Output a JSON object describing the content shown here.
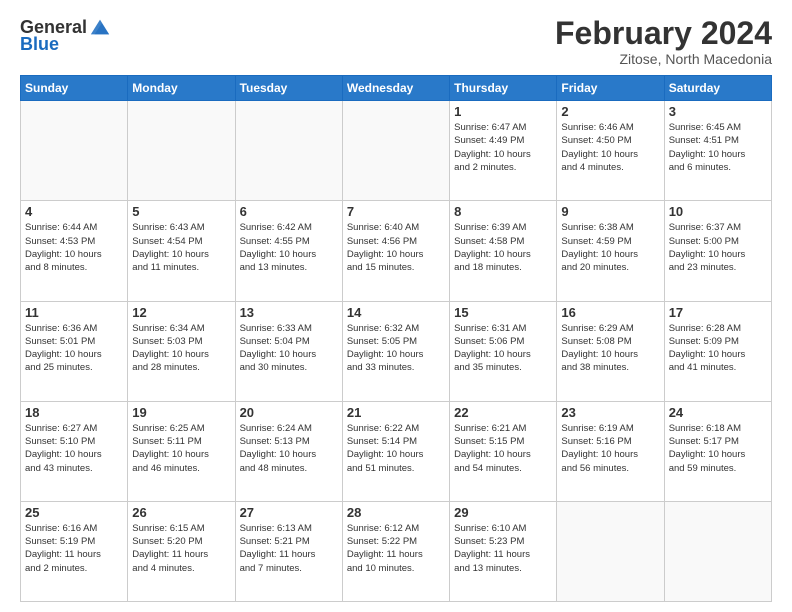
{
  "header": {
    "logo_general": "General",
    "logo_blue": "Blue",
    "month_title": "February 2024",
    "location": "Zitose, North Macedonia"
  },
  "days_of_week": [
    "Sunday",
    "Monday",
    "Tuesday",
    "Wednesday",
    "Thursday",
    "Friday",
    "Saturday"
  ],
  "weeks": [
    [
      {
        "day": "",
        "info": ""
      },
      {
        "day": "",
        "info": ""
      },
      {
        "day": "",
        "info": ""
      },
      {
        "day": "",
        "info": ""
      },
      {
        "day": "1",
        "info": "Sunrise: 6:47 AM\nSunset: 4:49 PM\nDaylight: 10 hours\nand 2 minutes."
      },
      {
        "day": "2",
        "info": "Sunrise: 6:46 AM\nSunset: 4:50 PM\nDaylight: 10 hours\nand 4 minutes."
      },
      {
        "day": "3",
        "info": "Sunrise: 6:45 AM\nSunset: 4:51 PM\nDaylight: 10 hours\nand 6 minutes."
      }
    ],
    [
      {
        "day": "4",
        "info": "Sunrise: 6:44 AM\nSunset: 4:53 PM\nDaylight: 10 hours\nand 8 minutes."
      },
      {
        "day": "5",
        "info": "Sunrise: 6:43 AM\nSunset: 4:54 PM\nDaylight: 10 hours\nand 11 minutes."
      },
      {
        "day": "6",
        "info": "Sunrise: 6:42 AM\nSunset: 4:55 PM\nDaylight: 10 hours\nand 13 minutes."
      },
      {
        "day": "7",
        "info": "Sunrise: 6:40 AM\nSunset: 4:56 PM\nDaylight: 10 hours\nand 15 minutes."
      },
      {
        "day": "8",
        "info": "Sunrise: 6:39 AM\nSunset: 4:58 PM\nDaylight: 10 hours\nand 18 minutes."
      },
      {
        "day": "9",
        "info": "Sunrise: 6:38 AM\nSunset: 4:59 PM\nDaylight: 10 hours\nand 20 minutes."
      },
      {
        "day": "10",
        "info": "Sunrise: 6:37 AM\nSunset: 5:00 PM\nDaylight: 10 hours\nand 23 minutes."
      }
    ],
    [
      {
        "day": "11",
        "info": "Sunrise: 6:36 AM\nSunset: 5:01 PM\nDaylight: 10 hours\nand 25 minutes."
      },
      {
        "day": "12",
        "info": "Sunrise: 6:34 AM\nSunset: 5:03 PM\nDaylight: 10 hours\nand 28 minutes."
      },
      {
        "day": "13",
        "info": "Sunrise: 6:33 AM\nSunset: 5:04 PM\nDaylight: 10 hours\nand 30 minutes."
      },
      {
        "day": "14",
        "info": "Sunrise: 6:32 AM\nSunset: 5:05 PM\nDaylight: 10 hours\nand 33 minutes."
      },
      {
        "day": "15",
        "info": "Sunrise: 6:31 AM\nSunset: 5:06 PM\nDaylight: 10 hours\nand 35 minutes."
      },
      {
        "day": "16",
        "info": "Sunrise: 6:29 AM\nSunset: 5:08 PM\nDaylight: 10 hours\nand 38 minutes."
      },
      {
        "day": "17",
        "info": "Sunrise: 6:28 AM\nSunset: 5:09 PM\nDaylight: 10 hours\nand 41 minutes."
      }
    ],
    [
      {
        "day": "18",
        "info": "Sunrise: 6:27 AM\nSunset: 5:10 PM\nDaylight: 10 hours\nand 43 minutes."
      },
      {
        "day": "19",
        "info": "Sunrise: 6:25 AM\nSunset: 5:11 PM\nDaylight: 10 hours\nand 46 minutes."
      },
      {
        "day": "20",
        "info": "Sunrise: 6:24 AM\nSunset: 5:13 PM\nDaylight: 10 hours\nand 48 minutes."
      },
      {
        "day": "21",
        "info": "Sunrise: 6:22 AM\nSunset: 5:14 PM\nDaylight: 10 hours\nand 51 minutes."
      },
      {
        "day": "22",
        "info": "Sunrise: 6:21 AM\nSunset: 5:15 PM\nDaylight: 10 hours\nand 54 minutes."
      },
      {
        "day": "23",
        "info": "Sunrise: 6:19 AM\nSunset: 5:16 PM\nDaylight: 10 hours\nand 56 minutes."
      },
      {
        "day": "24",
        "info": "Sunrise: 6:18 AM\nSunset: 5:17 PM\nDaylight: 10 hours\nand 59 minutes."
      }
    ],
    [
      {
        "day": "25",
        "info": "Sunrise: 6:16 AM\nSunset: 5:19 PM\nDaylight: 11 hours\nand 2 minutes."
      },
      {
        "day": "26",
        "info": "Sunrise: 6:15 AM\nSunset: 5:20 PM\nDaylight: 11 hours\nand 4 minutes."
      },
      {
        "day": "27",
        "info": "Sunrise: 6:13 AM\nSunset: 5:21 PM\nDaylight: 11 hours\nand 7 minutes."
      },
      {
        "day": "28",
        "info": "Sunrise: 6:12 AM\nSunset: 5:22 PM\nDaylight: 11 hours\nand 10 minutes."
      },
      {
        "day": "29",
        "info": "Sunrise: 6:10 AM\nSunset: 5:23 PM\nDaylight: 11 hours\nand 13 minutes."
      },
      {
        "day": "",
        "info": ""
      },
      {
        "day": "",
        "info": ""
      }
    ]
  ]
}
